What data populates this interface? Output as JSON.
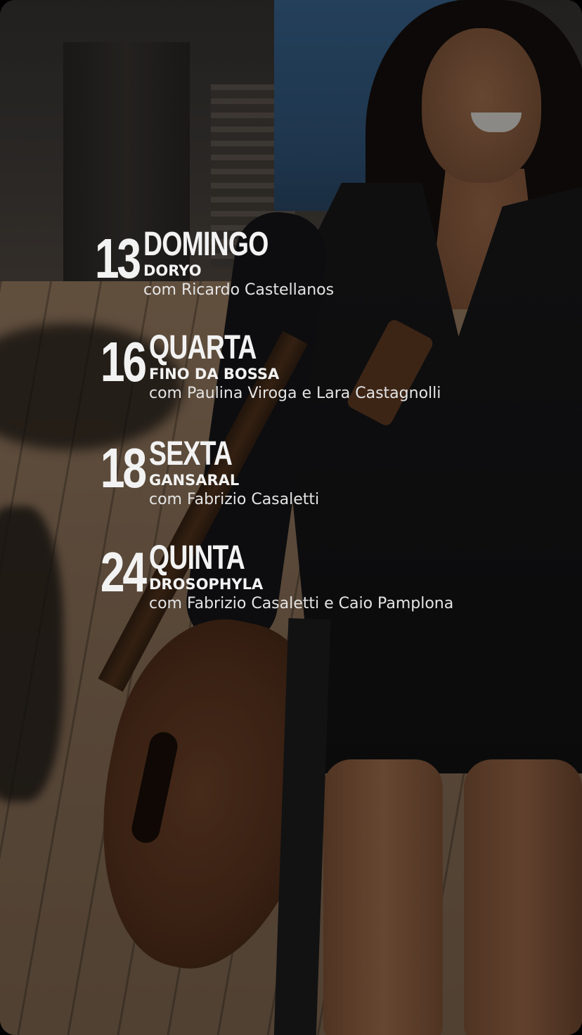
{
  "events": [
    {
      "day": "13",
      "weekday": "DOMINGO",
      "band": "DORYO",
      "with": "com Ricardo Castellanos"
    },
    {
      "day": "16",
      "weekday": "QUARTA",
      "band": "FINO DA BOSSA",
      "with": "com Paulina Viroga e Lara Castagnolli"
    },
    {
      "day": "18",
      "weekday": "SEXTA",
      "band": "GANSARAL",
      "with": "com Fabrizio Casaletti"
    },
    {
      "day": "24",
      "weekday": "QUINTA",
      "band": "DROSOPHYLA",
      "with": "com Fabrizio Casaletti e Caio Pamplona"
    }
  ],
  "colors": {
    "text": "#f2f2f2",
    "overlay": "rgba(0,0,0,0.42)",
    "dress": "#1b1b1d",
    "shirt_blue": "#3f6e9c"
  }
}
